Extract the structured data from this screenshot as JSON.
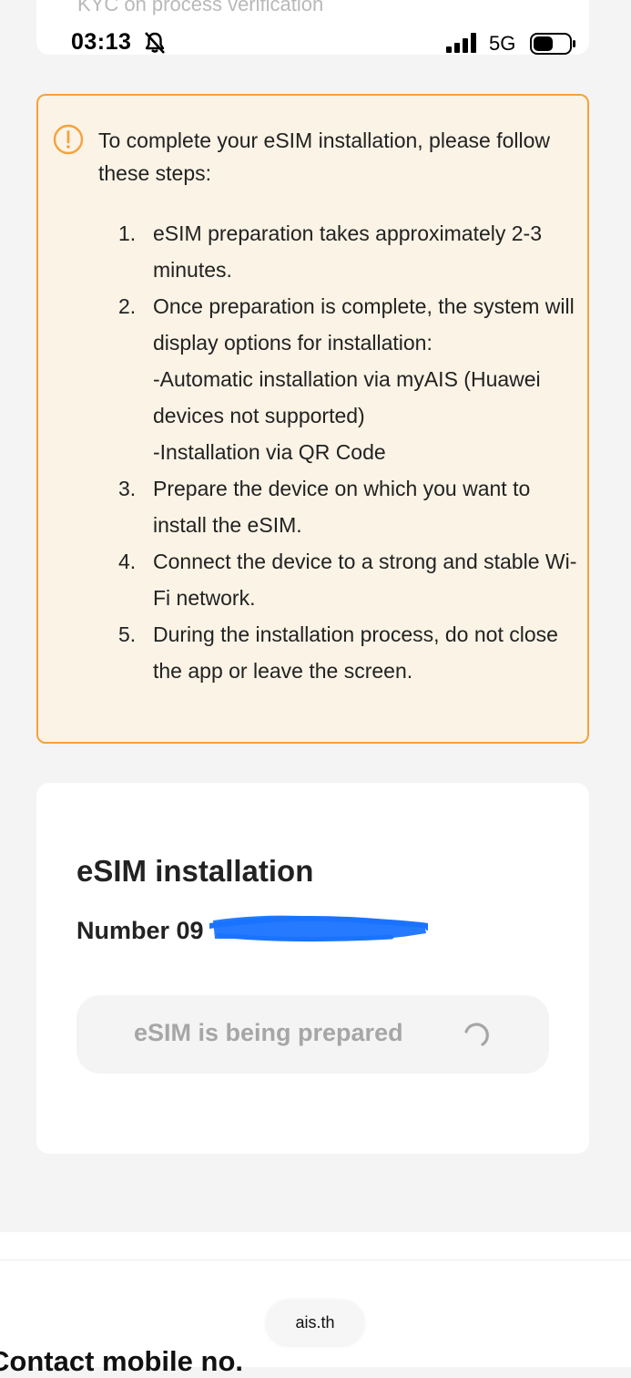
{
  "top_card": {
    "faded_text": "KYC on process verification"
  },
  "status_bar": {
    "time": "03:13",
    "network": "5G",
    "icons": [
      "bell-muted-icon",
      "signal-icon",
      "battery-icon"
    ]
  },
  "notice": {
    "icon": "warning-circle-icon",
    "intro": "To complete your eSIM installation, please follow these steps:",
    "steps": [
      {
        "num": "1.",
        "lines": [
          "eSIM preparation takes approximately 2-3 minutes."
        ]
      },
      {
        "num": "2.",
        "lines": [
          "Once preparation is complete, the system will display options for installation:",
          "-Automatic installation via myAIS (Huawei devices not supported)",
          "-Installation via QR Code"
        ]
      },
      {
        "num": "3.",
        "lines": [
          "Prepare the device on which you want to install the eSIM."
        ]
      },
      {
        "num": "4.",
        "lines": [
          "Connect the device to a strong and stable Wi-Fi network."
        ]
      },
      {
        "num": "5.",
        "lines": [
          "During the installation process, do not close the app or leave the screen."
        ]
      }
    ],
    "colors": {
      "border": "#f5a23a",
      "background": "#faf3e6"
    }
  },
  "install_card": {
    "title": "eSIM installation",
    "number_label": "Number 09",
    "button_label": "eSIM is being prepared",
    "button_icon": "loading-spinner-icon",
    "redaction_color": "#1a73ff"
  },
  "footer": {
    "url": "ais.th",
    "contact_heading": "Contact mobile no."
  }
}
